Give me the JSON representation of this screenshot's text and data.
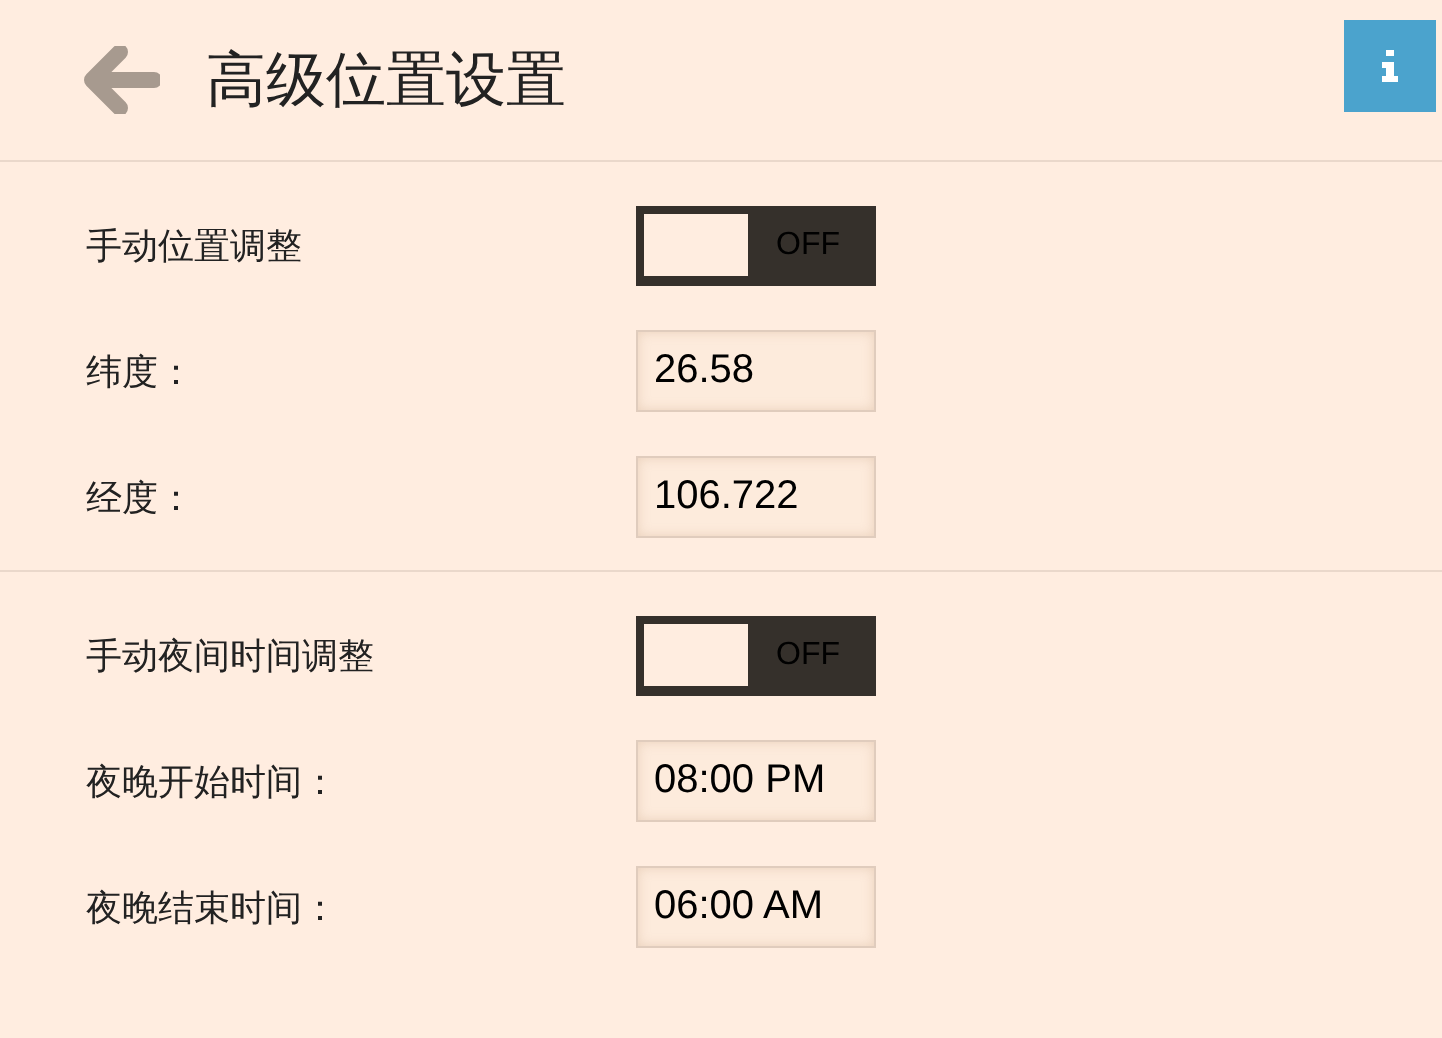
{
  "header": {
    "title": "高级位置设置"
  },
  "sections": [
    {
      "rows": [
        {
          "kind": "toggle",
          "label": "手动位置调整",
          "on": false,
          "state_label": "OFF"
        },
        {
          "kind": "field",
          "label": "纬度：",
          "value": "26.58"
        },
        {
          "kind": "field",
          "label": "经度：",
          "value": "106.722"
        }
      ]
    },
    {
      "rows": [
        {
          "kind": "toggle",
          "label": "手动夜间时间调整",
          "on": false,
          "state_label": "OFF"
        },
        {
          "kind": "field",
          "label": "夜晚开始时间：",
          "value": "08:00 PM"
        },
        {
          "kind": "field",
          "label": "夜晚结束时间：",
          "value": "06:00 AM"
        }
      ]
    }
  ]
}
